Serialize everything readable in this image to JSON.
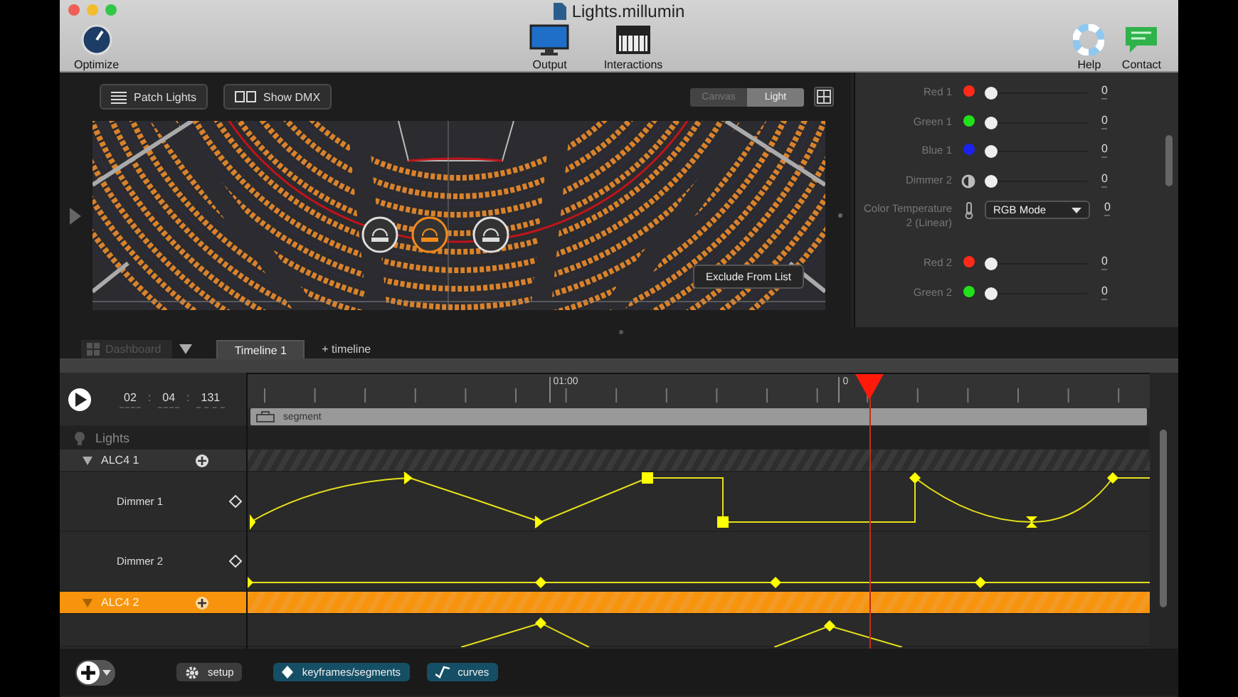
{
  "window": {
    "title": "Lights.millumin"
  },
  "toolbar": [
    {
      "kind": "optimize",
      "label": "Optimize"
    },
    {
      "kind": "output",
      "label": "Output"
    },
    {
      "kind": "interactions",
      "label": "Interactions"
    },
    {
      "kind": "help",
      "label": "Help"
    },
    {
      "kind": "contact",
      "label": "Contact"
    }
  ],
  "viewer": {
    "buttons": [
      {
        "kind": "patch",
        "label": "Patch Lights"
      },
      {
        "kind": "dmx",
        "label": "Show DMX"
      }
    ],
    "view_modes": [
      {
        "label": "Canvas",
        "selected": false
      },
      {
        "label": "Light",
        "selected": true
      }
    ],
    "tooltip": "Exclude From List"
  },
  "properties": [
    {
      "kind": "color",
      "label": "Red 1",
      "color": "#ff2a1a",
      "level": 0,
      "reading": "0"
    },
    {
      "kind": "color",
      "label": "Green 1",
      "color": "#22e01a",
      "level": 0,
      "reading": "0"
    },
    {
      "kind": "color",
      "label": "Blue 1",
      "color": "#1a22f0",
      "level": 0,
      "reading": "0"
    },
    {
      "kind": "intensity",
      "label": "Dimmer 2",
      "level": 0,
      "reading": "0"
    },
    {
      "kind": "mode",
      "label": "Color Temperature 2 (Linear)",
      "value": "RGB Mode",
      "reading": "0"
    },
    {
      "kind": "color",
      "label": "Red 2",
      "color": "#ff2a1a",
      "level": 0,
      "reading": "0"
    },
    {
      "kind": "color",
      "label": "Green 2",
      "color": "#22e01a",
      "level": 0,
      "reading": "0"
    }
  ],
  "tabs": [
    {
      "kind": "dashboard",
      "label": "Dashboard",
      "selected": false,
      "disabled": true
    },
    {
      "kind": "timeline",
      "label": "Timeline 1",
      "selected": true,
      "disabled": false
    },
    {
      "kind": "add",
      "label": "+ timeline",
      "selected": false,
      "disabled": false
    }
  ],
  "timeline": {
    "time": [
      "02",
      "04",
      "131"
    ],
    "time_separator": ":",
    "ruler_labels": [
      {
        "label": "01:00",
        "level": 0.334
      },
      {
        "label": "0",
        "level": 0.655
      }
    ],
    "playhead": {
      "level": 0.689
    },
    "segment": "segment",
    "group": "Lights",
    "devices": [
      {
        "label": "ALC4  1",
        "expanded": true,
        "selected": false,
        "children": [
          {
            "label": "Dimmer 1"
          },
          {
            "label": "Dimmer 2"
          }
        ]
      },
      {
        "label": "ALC4  2",
        "expanded": true,
        "selected": true
      }
    ]
  },
  "modes": [
    {
      "kind": "setup",
      "label": "setup",
      "selected": false
    },
    {
      "kind": "keyframes",
      "label": "keyframes/segments",
      "selected": true
    },
    {
      "kind": "curves",
      "label": "curves",
      "selected": true
    }
  ]
}
